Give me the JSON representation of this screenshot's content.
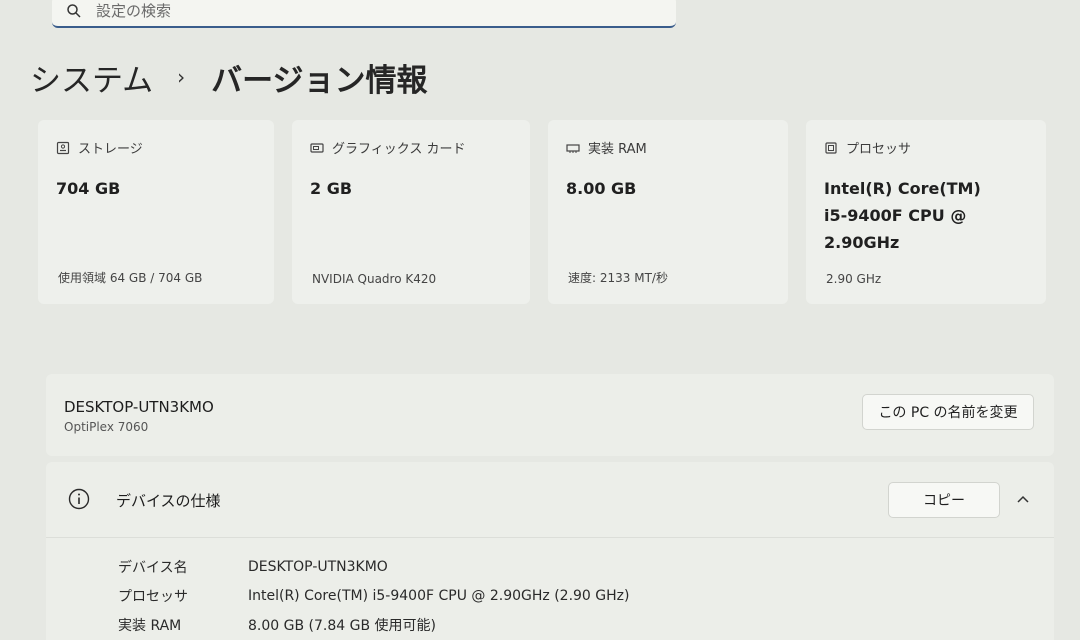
{
  "search": {
    "placeholder": "設定の検索"
  },
  "breadcrumb": {
    "parent": "システム",
    "separator": "›",
    "current": "バージョン情報"
  },
  "cards": [
    {
      "title": "ストレージ",
      "value_lines": [
        "704 GB"
      ],
      "sub": "使用領域 64 GB / 704 GB",
      "icon": "storage-icon"
    },
    {
      "title": "グラフィックス カード",
      "value_lines": [
        "2 GB"
      ],
      "sub": "NVIDIA Quadro K420",
      "icon": "gpu-icon"
    },
    {
      "title": "実装 RAM",
      "value_lines": [
        "8.00 GB"
      ],
      "sub": "速度: 2133 MT/秒",
      "icon": "ram-icon"
    },
    {
      "title": "プロセッサ",
      "value_lines": [
        "Intel(R) Core(TM)",
        "i5-9400F CPU @",
        "2.90GHz"
      ],
      "sub": "2.90 GHz",
      "icon": "cpu-icon"
    }
  ],
  "device": {
    "name": "DESKTOP-UTN3KMO",
    "model": "OptiPlex 7060",
    "rename_label": "この PC の名前を変更"
  },
  "specs": {
    "title": "デバイスの仕様",
    "copy_label": "コピー",
    "rows": [
      {
        "key": "デバイス名",
        "value": "DESKTOP-UTN3KMO"
      },
      {
        "key": "プロセッサ",
        "value": "Intel(R) Core(TM) i5-9400F CPU @ 2.90GHz (2.90 GHz)"
      },
      {
        "key": "実装 RAM",
        "value": "8.00 GB (7.84 GB 使用可能)"
      }
    ]
  }
}
